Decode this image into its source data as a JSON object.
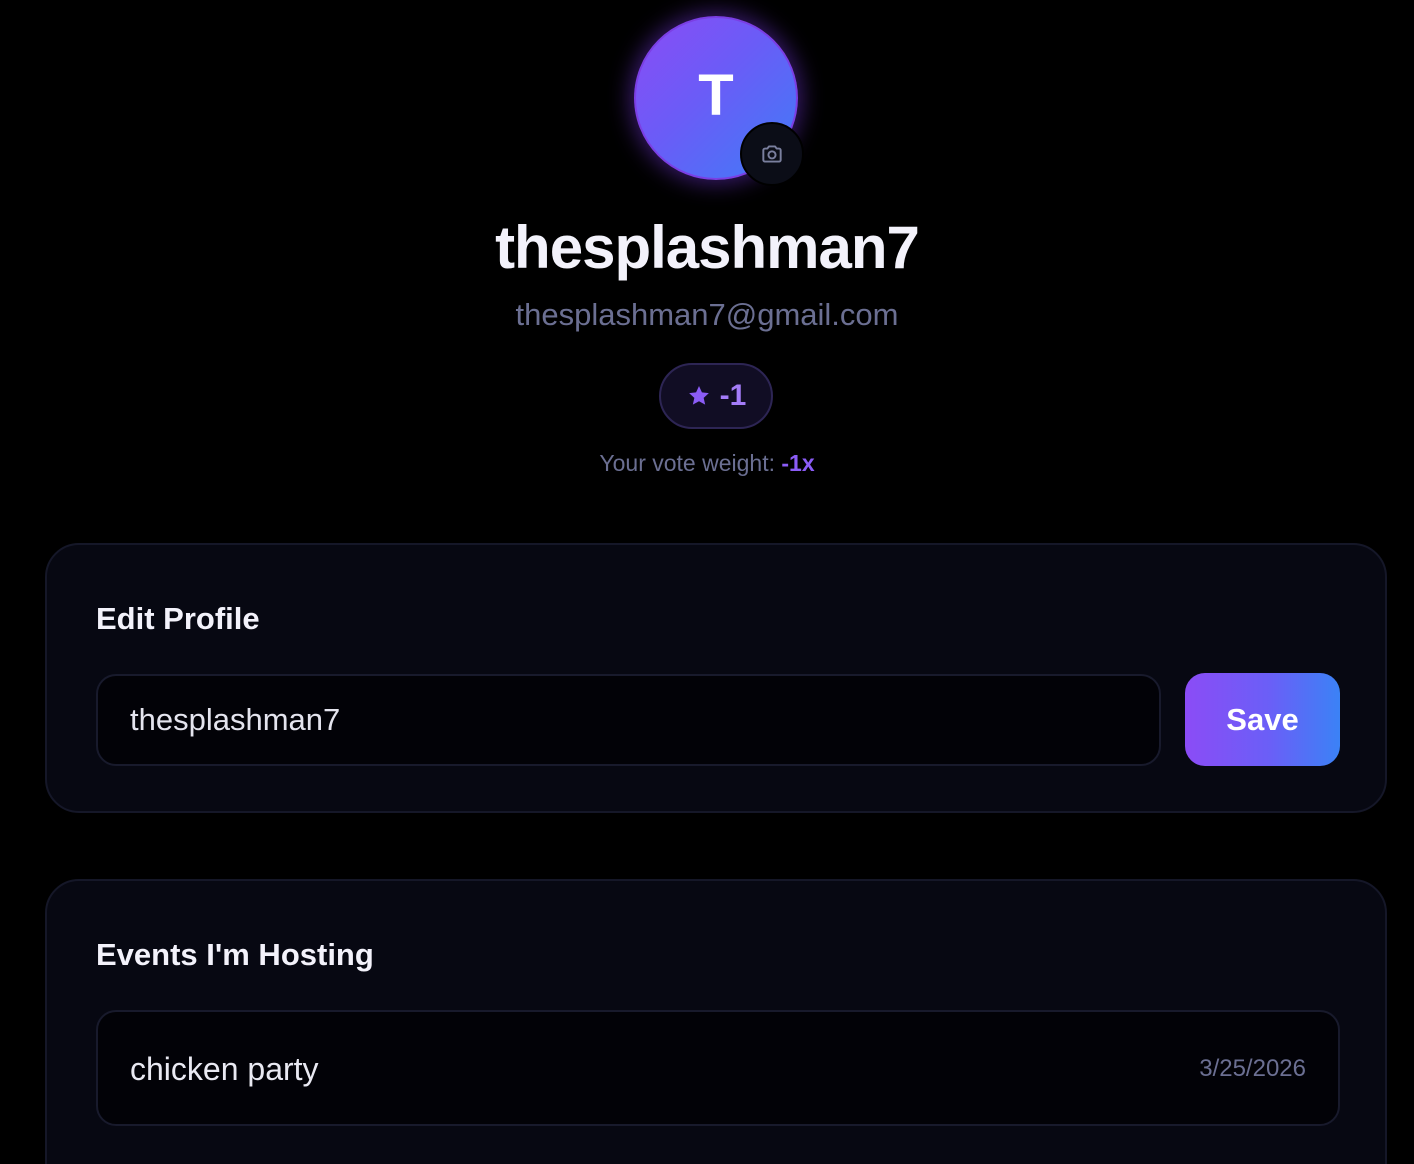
{
  "profile": {
    "avatar_initial": "T",
    "username": "thesplashman7",
    "email": "thesplashman7@gmail.com",
    "reputation": "-1",
    "vote_weight_label": "Your vote weight: ",
    "vote_weight_value": "-1x",
    "icons": {
      "camera": "camera-icon",
      "star": "star-icon"
    }
  },
  "edit_profile": {
    "title": "Edit Profile",
    "name_input_value": "thesplashman7",
    "save_label": "Save"
  },
  "events": {
    "title": "Events I'm Hosting",
    "items": [
      {
        "name": "chicken party",
        "date": "3/25/2026"
      }
    ]
  },
  "colors": {
    "background": "#000000",
    "card": "#070812",
    "accent_purple": "#8b5cf6",
    "accent_blue": "#3b82f6",
    "muted_text": "#6b6f92"
  }
}
